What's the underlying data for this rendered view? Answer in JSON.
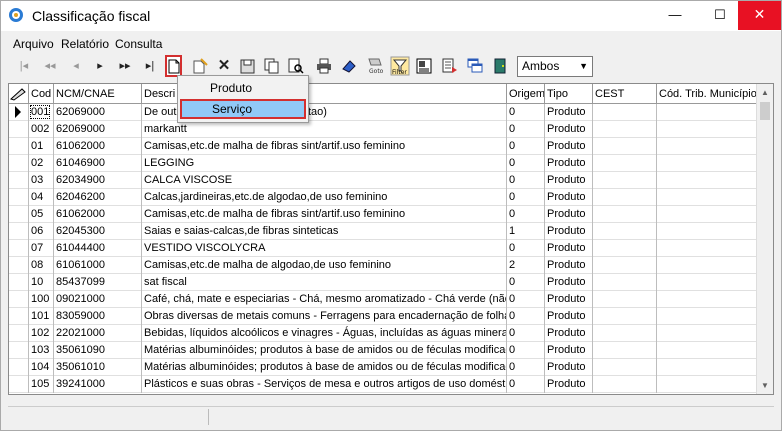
{
  "window": {
    "title": "Classificação fiscal",
    "min_glyph": "—",
    "max_glyph": "☐",
    "close_glyph": "✕"
  },
  "menu": {
    "arquivo": "Arquivo",
    "relatorio": "Relatório",
    "consulta": "Consulta"
  },
  "toolbar": {
    "first": "|◂",
    "prev_page": "◂◂",
    "prev": "◂",
    "next": "▸",
    "next_page": "▸▸",
    "last": "▸|",
    "filter_select_value": "Ambos"
  },
  "dropdown": {
    "items": [
      "Produto",
      "Serviço"
    ]
  },
  "grid": {
    "headers": [
      "Cod",
      "NCM/CNAE",
      "Descri",
      "Origem",
      "Tipo",
      "CEST",
      "Cód. Trib. Município"
    ],
    "rows": [
      {
        "cod": "001",
        "ncm": "62069000",
        "desc": "De out",
        "desc_tail": "tao)",
        "origem": "0",
        "tipo": "Produto"
      },
      {
        "cod": "002",
        "ncm": "62069000",
        "desc": "markantt",
        "desc_tail": "",
        "origem": "0",
        "tipo": "Produto"
      },
      {
        "cod": "01",
        "ncm": "61062000",
        "desc": "Camisas,etc.de malha de fibras sint/artif.uso feminino",
        "desc_tail": "",
        "origem": "0",
        "tipo": "Produto"
      },
      {
        "cod": "02",
        "ncm": "61046900",
        "desc": "LEGGING",
        "desc_tail": "",
        "origem": "0",
        "tipo": "Produto"
      },
      {
        "cod": "03",
        "ncm": "62034900",
        "desc": "CALCA VISCOSE",
        "desc_tail": "",
        "origem": "0",
        "tipo": "Produto"
      },
      {
        "cod": "04",
        "ncm": "62046200",
        "desc": "Calcas,jardineiras,etc.de algodao,de uso feminino",
        "desc_tail": "",
        "origem": "0",
        "tipo": "Produto"
      },
      {
        "cod": "05",
        "ncm": "61062000",
        "desc": "Camisas,etc.de malha de fibras sint/artif.uso feminino",
        "desc_tail": "",
        "origem": "0",
        "tipo": "Produto"
      },
      {
        "cod": "06",
        "ncm": "62045300",
        "desc": "Saias e saias-calcas,de fibras sinteticas",
        "desc_tail": "",
        "origem": "1",
        "tipo": "Produto"
      },
      {
        "cod": "07",
        "ncm": "61044400",
        "desc": "VESTIDO VISCOLYCRA",
        "desc_tail": "",
        "origem": "0",
        "tipo": "Produto"
      },
      {
        "cod": "08",
        "ncm": "61061000",
        "desc": "Camisas,etc.de malha de algodao,de uso feminino",
        "desc_tail": "",
        "origem": "2",
        "tipo": "Produto"
      },
      {
        "cod": "10",
        "ncm": "85437099",
        "desc": "sat fiscal",
        "desc_tail": "",
        "origem": "0",
        "tipo": "Produto"
      },
      {
        "cod": "100",
        "ncm": "09021000",
        "desc": "Café, chá, mate e especiarias - Chá, mesmo aromatizado - Chá verde (não",
        "desc_tail": "",
        "origem": "0",
        "tipo": "Produto"
      },
      {
        "cod": "101",
        "ncm": "83059000",
        "desc": "Obras diversas de metais comuns - Ferragens para encadernação de folhas",
        "desc_tail": "",
        "origem": "0",
        "tipo": "Produto"
      },
      {
        "cod": "102",
        "ncm": "22021000",
        "desc": "Bebidas, líquidos alcoólicos e vinagres - Águas, incluídas as águas minerais e",
        "desc_tail": "",
        "origem": "0",
        "tipo": "Produto"
      },
      {
        "cod": "103",
        "ncm": "35061090",
        "desc": "Matérias albuminóides; produtos à base de amidos ou de féculas modificado",
        "desc_tail": "",
        "origem": "0",
        "tipo": "Produto"
      },
      {
        "cod": "104",
        "ncm": "35061010",
        "desc": "Matérias albuminóides; produtos à base de amidos ou de féculas modificado",
        "desc_tail": "",
        "origem": "0",
        "tipo": "Produto"
      },
      {
        "cod": "105",
        "ncm": "39241000",
        "desc": "Plásticos e suas obras - Serviços de mesa e outros artigos de uso doméstico",
        "desc_tail": "",
        "origem": "0",
        "tipo": "Produto"
      }
    ]
  },
  "colors": {
    "highlight_red": "#d32f2f",
    "selected_blue": "#91c9f7",
    "close_red": "#e81123"
  }
}
